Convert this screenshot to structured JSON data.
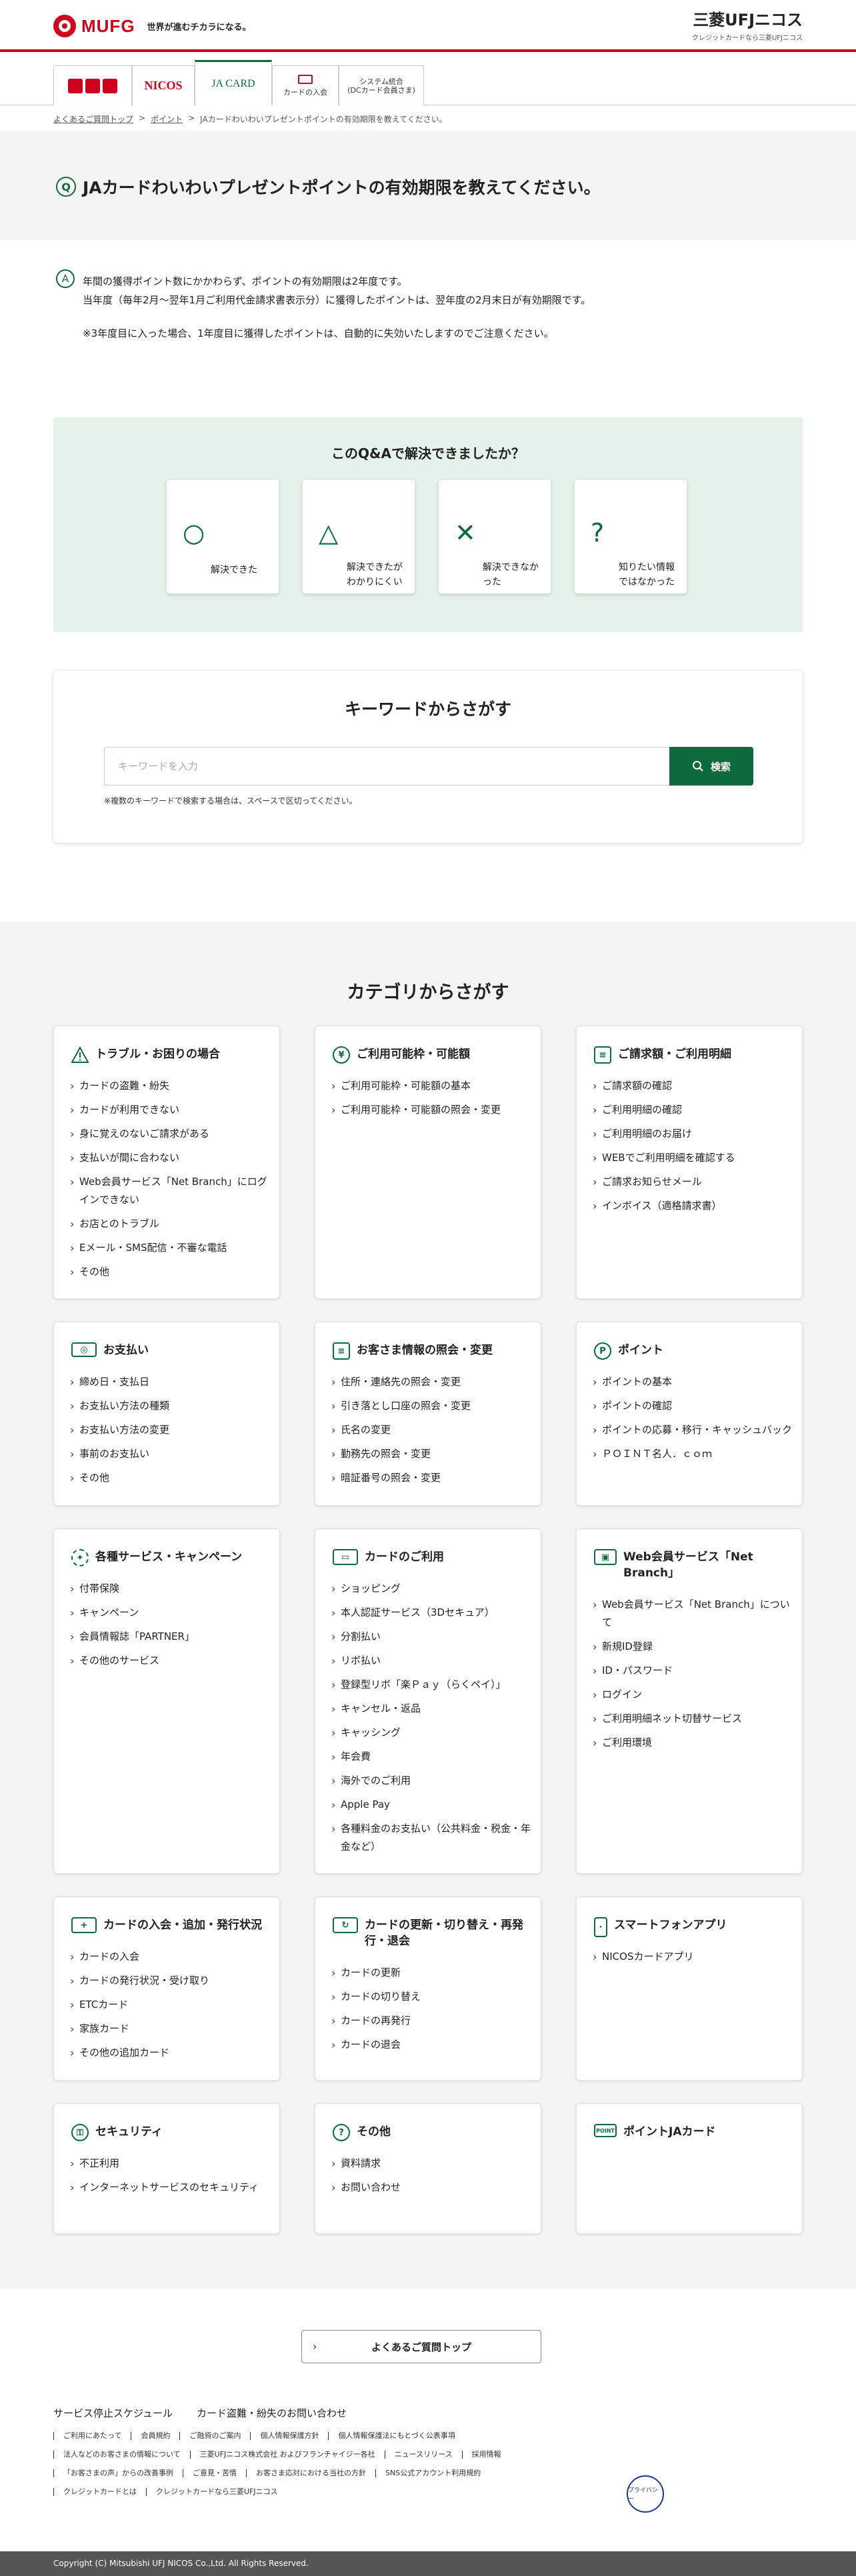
{
  "header": {
    "mufg_logo": "MUFG",
    "mufg_tagline": "世界が進むチカラになる。",
    "nicos_title": "三菱UFJニコス",
    "nicos_sub": "クレジットカードなら三菱UFJニコス"
  },
  "brand_tabs": [
    {
      "label": ""
    },
    {
      "label": "NICOS"
    },
    {
      "label": "JA CARD"
    },
    {
      "label": "カードの入会"
    },
    {
      "label": "システム統合\n(DCカード会員さま)"
    }
  ],
  "breadcrumb": {
    "items": [
      "よくあるご質問トップ",
      "ポイント",
      "JAカードわいわいプレゼントポイントの有効期限を教えてください。"
    ],
    "separator": ">"
  },
  "question": {
    "mark": "Q",
    "text": "JAカードわいわいプレゼントポイントの有効期限を教えてください。"
  },
  "answer": {
    "mark": "A",
    "line1": "年間の獲得ポイント数にかかわらず、ポイントの有効期限は2年度です。",
    "line2": "当年度（毎年2月〜翌年1月ご利用代金請求書表示分）に獲得したポイントは、翌年度の2月末日が有効期限です。",
    "note": "※3年度目に入った場合、1年度目に獲得したポイントは、自動的に失効いたしますのでご注意ください。"
  },
  "feedback": {
    "title": "このQ&Aで解決できましたか？",
    "buttons": [
      {
        "icon": "○",
        "label": "解決できた"
      },
      {
        "icon": "△",
        "label": "解決できたが\nわかりにくい"
      },
      {
        "icon": "✕",
        "label": "解決できなか\nった"
      },
      {
        "icon": "?",
        "label": "知りたい情報\nではなかった"
      }
    ]
  },
  "search": {
    "title": "キーワードからさがす",
    "placeholder": "キーワードを入力",
    "button_label": "検索",
    "hint": "※複数のキーワードで検索する場合は、スペースで区切ってください。"
  },
  "categories": {
    "title": "カテゴリからさがす",
    "cards": [
      {
        "name": "トラブル・お困りの場合",
        "items": [
          "カードの盗難・紛失",
          "カードが利用できない",
          "身に覚えのないご請求がある",
          "支払いが間に合わない",
          "Web会員サービス「Net Branch」にログインできない",
          "お店とのトラブル",
          "Eメール・SMS配信・不審な電話",
          "その他"
        ]
      },
      {
        "name": "ご利用可能枠・可能額",
        "items": [
          "ご利用可能枠・可能額の基本",
          "ご利用可能枠・可能額の照会・変更"
        ]
      },
      {
        "name": "ご請求額・ご利用明細",
        "items": [
          "ご請求額の確認",
          "ご利用明細の確認",
          "ご利用明細のお届け",
          "WEBでご利用明細を確認する",
          "ご請求お知らせメール",
          "インボイス（適格請求書）"
        ]
      },
      {
        "name": "お支払い",
        "items": [
          "締め日・支払日",
          "お支払い方法の種類",
          "お支払い方法の変更",
          "事前のお支払い",
          "その他"
        ]
      },
      {
        "name": "お客さま情報の照会・変更",
        "items": [
          "住所・連絡先の照会・変更",
          "引き落とし口座の照会・変更",
          "氏名の変更",
          "勤務先の照会・変更",
          "暗証番号の照会・変更"
        ]
      },
      {
        "name": "ポイント",
        "items": [
          "ポイントの基本",
          "ポイントの確認",
          "ポイントの応募・移行・キャッシュバック",
          "ＰＯＩＮＴ名人．ｃｏｍ"
        ]
      },
      {
        "name": "各種サービス・キャンペーン",
        "items": [
          "付帯保険",
          "キャンペーン",
          "会員情報誌「PARTNER」",
          "その他のサービス"
        ]
      },
      {
        "name": "カードのご利用",
        "items": [
          "ショッピング",
          "本人認証サービス（3Dセキュア）",
          "分割払い",
          "リボ払い",
          "登録型リボ「楽Ｐａｙ（らくペイ）」",
          "キャンセル・返品",
          "キャッシング",
          "年会費",
          "海外でのご利用",
          "Apple Pay",
          "各種料金のお支払い（公共料金・税金・年金など）"
        ]
      },
      {
        "name": "Web会員サービス「Net Branch」",
        "items": [
          "Web会員サービス「Net Branch」について",
          "新規ID登録",
          "ID・パスワード",
          "ログイン",
          "ご利用明細ネット切替サービス",
          "ご利用環境"
        ]
      },
      {
        "name": "カードの入会・追加・発行状況",
        "items": [
          "カードの入会",
          "カードの発行状況・受け取り",
          "ETCカード",
          "家族カード",
          "その他の追加カード"
        ]
      },
      {
        "name": "カードの更新・切り替え・再発行・退会",
        "items": [
          "カードの更新",
          "カードの切り替え",
          "カードの再発行",
          "カードの退会"
        ]
      },
      {
        "name": "スマートフォンアプリ",
        "items": [
          "NICOSカードアプリ"
        ]
      },
      {
        "name": "セキュリティ",
        "items": [
          "不正利用",
          "インターネットサービスのセキュリティ"
        ]
      },
      {
        "name": "その他",
        "items": [
          "資料請求",
          "お問い合わせ"
        ]
      },
      {
        "name": "ポイントJAカード",
        "items": []
      }
    ]
  },
  "footer": {
    "top_button": "よくあるご質問トップ",
    "main_links": [
      "サービス停止スケジュール",
      "カード盗難・紛失のお問い合わせ"
    ],
    "row1": [
      "ご利用にあたって",
      "会員規約",
      "ご融資のご案内",
      "個人情報保護方針",
      "個人情報保護法にもとづく公表事項"
    ],
    "row2": [
      "法人などのお客さまの情報について",
      "三菱UFJニコス株式会社 およびフランチャイジー各社",
      "ニュースリリース",
      "採用情報"
    ],
    "row3": [
      "「お客さまの声」からの改善事例",
      "ご意見・苦情",
      "お客さま応対における当社の方針",
      "SNS公式アカウント利用規約"
    ],
    "row4": [
      "クレジットカードとは",
      "クレジットカードなら三菱UFJニコス"
    ],
    "privacy_mark": "プライバシー",
    "copyright": "Copyright (C) Mitsubishi UFJ NICOS Co.,Ltd. All Rights Reserved."
  },
  "colors": {
    "brand_red": "#d0021b",
    "brand_green": "#0d6b3b"
  }
}
